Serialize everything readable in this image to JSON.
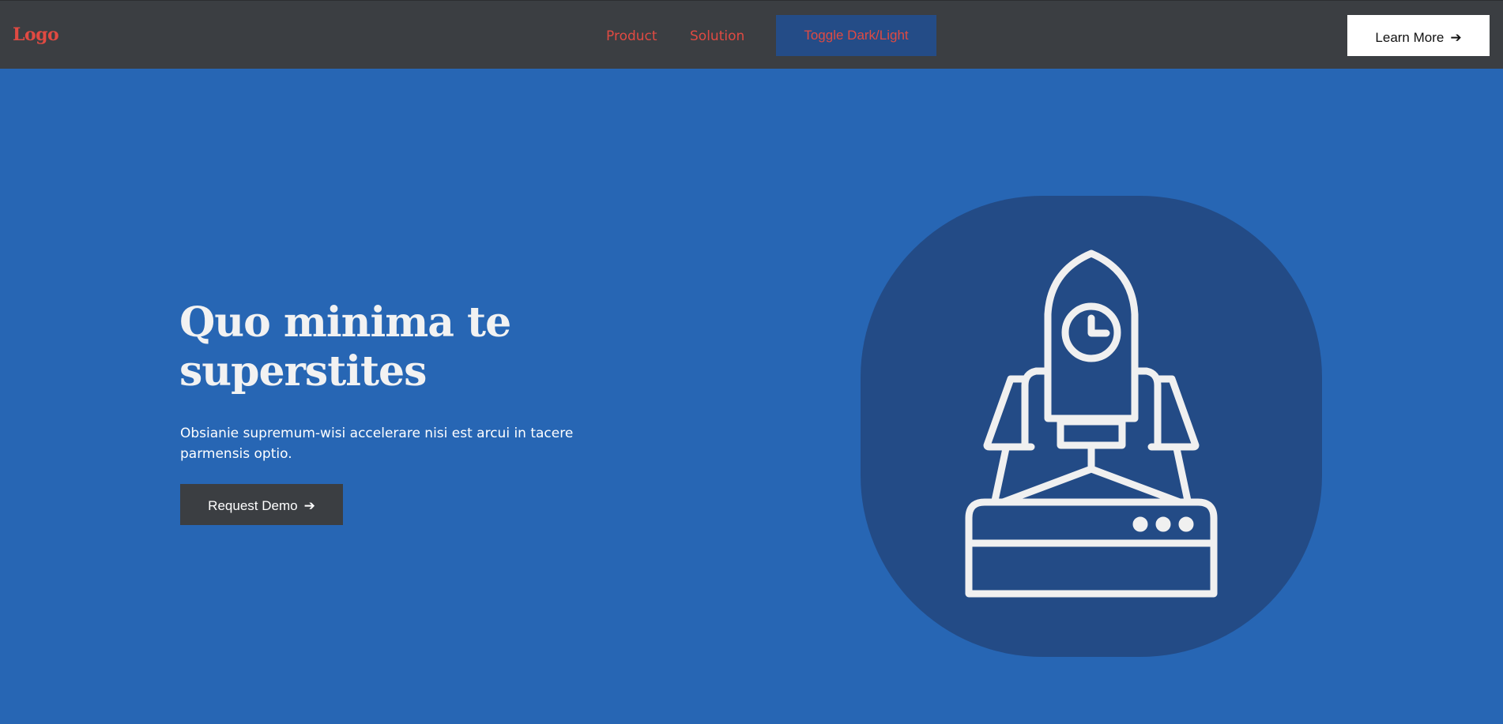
{
  "navbar": {
    "logo": "Logo",
    "links": [
      {
        "label": "Product"
      },
      {
        "label": "Solution"
      }
    ],
    "toggle_label": "Toggle Dark/Light",
    "learn_more_label": "Learn More",
    "learn_more_arrow": "➔"
  },
  "hero": {
    "title": "Quo minima te superstites",
    "description": "Obsianie supremum-wisi accelerare nisi est arcui in tacere parmensis optio.",
    "cta_label": "Request Demo",
    "cta_arrow": "➔",
    "illustration_icon": "rocket-launch-icon"
  },
  "colors": {
    "page_background": "#2766b4",
    "navbar_background": "#3b3e42",
    "accent_red": "#e04a42",
    "toggle_background": "#244c87",
    "illustration_background": "#234b86",
    "icon_stroke": "#f0f0f0"
  }
}
